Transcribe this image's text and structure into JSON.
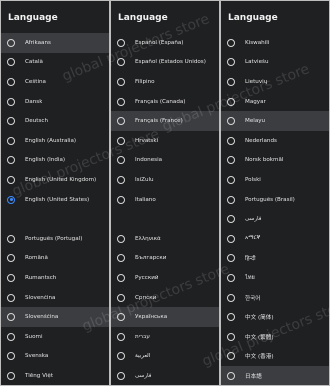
{
  "watermark": "global projectors store",
  "colors": {
    "background": "#1f2022",
    "highlight": "#3b3d41",
    "selected": "#3d8bff"
  },
  "screens": [
    {
      "title": "Language",
      "items": [
        {
          "label": "Afrikaans",
          "highlighted": true,
          "selected": false
        },
        {
          "label": "Català",
          "highlighted": false,
          "selected": false
        },
        {
          "label": "Čeština",
          "highlighted": false,
          "selected": false
        },
        {
          "label": "Dansk",
          "highlighted": false,
          "selected": false
        },
        {
          "label": "Deutsch",
          "highlighted": false,
          "selected": false
        },
        {
          "label": "English (Australia)",
          "highlighted": false,
          "selected": false
        },
        {
          "label": "English (India)",
          "highlighted": false,
          "selected": false
        },
        {
          "label": "English (United Kingdom)",
          "highlighted": false,
          "selected": false
        },
        {
          "label": "English (United States)",
          "highlighted": false,
          "selected": true
        },
        {
          "label": "",
          "highlighted": false,
          "selected": false,
          "hidden": true
        },
        {
          "label": "Português (Portugal)",
          "highlighted": false,
          "selected": false
        },
        {
          "label": "Română",
          "highlighted": false,
          "selected": false
        },
        {
          "label": "Rumantsch",
          "highlighted": false,
          "selected": false
        },
        {
          "label": "Slovenčina",
          "highlighted": false,
          "selected": false
        },
        {
          "label": "Slovenščina",
          "highlighted": true,
          "selected": false
        },
        {
          "label": "Suomi",
          "highlighted": false,
          "selected": false
        },
        {
          "label": "Svenska",
          "highlighted": false,
          "selected": false
        },
        {
          "label": "Tiếng Việt",
          "highlighted": false,
          "selected": false
        },
        {
          "label": "Türkçe",
          "highlighted": false,
          "selected": false
        }
      ]
    },
    {
      "title": "Language",
      "items": [
        {
          "label": "Español (España)",
          "highlighted": false,
          "selected": false
        },
        {
          "label": "Español (Estados Unidos)",
          "highlighted": false,
          "selected": false
        },
        {
          "label": "Filipino",
          "highlighted": false,
          "selected": false
        },
        {
          "label": "Français (Canada)",
          "highlighted": false,
          "selected": false
        },
        {
          "label": "Français (France)",
          "highlighted": true,
          "selected": false
        },
        {
          "label": "Hrvatski",
          "highlighted": false,
          "selected": false
        },
        {
          "label": "Indonesia",
          "highlighted": false,
          "selected": false
        },
        {
          "label": "IsiZulu",
          "highlighted": false,
          "selected": false
        },
        {
          "label": "Italiano",
          "highlighted": false,
          "selected": false
        },
        {
          "label": "",
          "highlighted": false,
          "selected": false,
          "hidden": true
        },
        {
          "label": "Ελληνικά",
          "highlighted": false,
          "selected": false
        },
        {
          "label": "Български",
          "highlighted": false,
          "selected": false
        },
        {
          "label": "Русский",
          "highlighted": false,
          "selected": false
        },
        {
          "label": "Српски",
          "highlighted": false,
          "selected": false
        },
        {
          "label": "Українська",
          "highlighted": true,
          "selected": false
        },
        {
          "label": "עברית",
          "highlighted": false,
          "selected": false
        },
        {
          "label": "العربية",
          "highlighted": false,
          "selected": false
        },
        {
          "label": "فارسی",
          "highlighted": false,
          "selected": false
        },
        {
          "label": "አማርኛ",
          "highlighted": false,
          "selected": false
        }
      ]
    },
    {
      "title": "Language",
      "items": [
        {
          "label": "Kiswahili",
          "highlighted": false,
          "selected": false
        },
        {
          "label": "Latviešu",
          "highlighted": false,
          "selected": false
        },
        {
          "label": "Lietuvių",
          "highlighted": false,
          "selected": false
        },
        {
          "label": "Magyar",
          "highlighted": false,
          "selected": false
        },
        {
          "label": "Melayu",
          "highlighted": true,
          "selected": false
        },
        {
          "label": "Nederlands",
          "highlighted": false,
          "selected": false
        },
        {
          "label": "Norsk bokmål",
          "highlighted": false,
          "selected": false
        },
        {
          "label": "Polski",
          "highlighted": false,
          "selected": false
        },
        {
          "label": "Português (Brasil)",
          "highlighted": false,
          "selected": false
        },
        {
          "label": "فارسی",
          "highlighted": false,
          "selected": false
        },
        {
          "label": "አማርኛ",
          "highlighted": false,
          "selected": false
        },
        {
          "label": "हिन्दी",
          "highlighted": false,
          "selected": false
        },
        {
          "label": "ไทย",
          "highlighted": false,
          "selected": false
        },
        {
          "label": "한국어",
          "highlighted": false,
          "selected": false
        },
        {
          "label": "中文 (简体)",
          "highlighted": false,
          "selected": false
        },
        {
          "label": "中文 (繁體)",
          "highlighted": false,
          "selected": false
        },
        {
          "label": "中文 (香港)",
          "highlighted": false,
          "selected": false
        },
        {
          "label": "日本語",
          "highlighted": true,
          "selected": false
        },
        {
          "label": "",
          "highlighted": false,
          "selected": false,
          "hidden": true
        }
      ]
    }
  ]
}
